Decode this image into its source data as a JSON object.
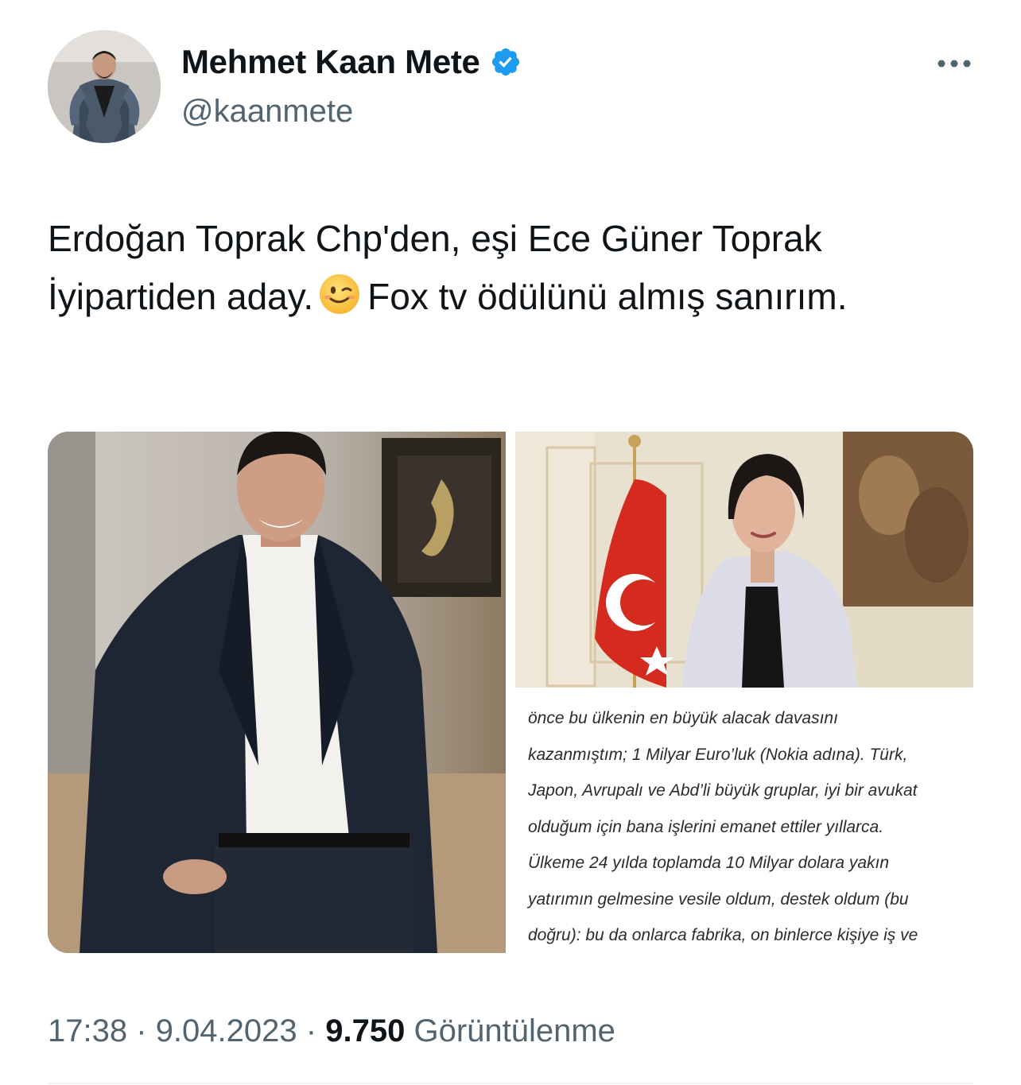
{
  "tweet": {
    "author": {
      "display_name": "Mehmet Kaan Mete",
      "handle": "@kaanmete",
      "verified": true
    },
    "text_before_emoji": "Erdoğan Toprak Chp'den, eşi Ece Güner Toprak İyipartiden aday.",
    "emoji": "winking-face",
    "text_after_emoji": "Fox tv ödülünü almış sanırım.",
    "media": {
      "screenshot_text_lines": [
        "önce bu ülkenin en büyük alacak davasını",
        "kazanmıştım; 1 Milyar Euro’luk (Nokia adına). Türk,",
        "Japon, Avrupalı ve Abd’li büyük gruplar, iyi bir avukat",
        "olduğum için bana işlerini emanet ettiler yıllarca.",
        "Ülkeme 24 yılda toplamda 10 Milyar dolara yakın",
        "yatırımın gelmesine vesile oldum, destek oldum (bu",
        "doğru): bu da onlarca fabrika, on binlerce kişiye iş ve"
      ]
    },
    "meta": {
      "time": "17:38",
      "separator1": "·",
      "date": "9.04.2023",
      "separator2": "·",
      "views_count": "9.750",
      "views_label": "Görüntülenme"
    }
  },
  "icons": {
    "verified": "verified-badge-icon",
    "more": "more-icon"
  },
  "colors": {
    "text_primary": "#0f1419",
    "text_secondary": "#536471",
    "verified_blue": "#1d9bf0",
    "divider": "#eff3f4"
  }
}
